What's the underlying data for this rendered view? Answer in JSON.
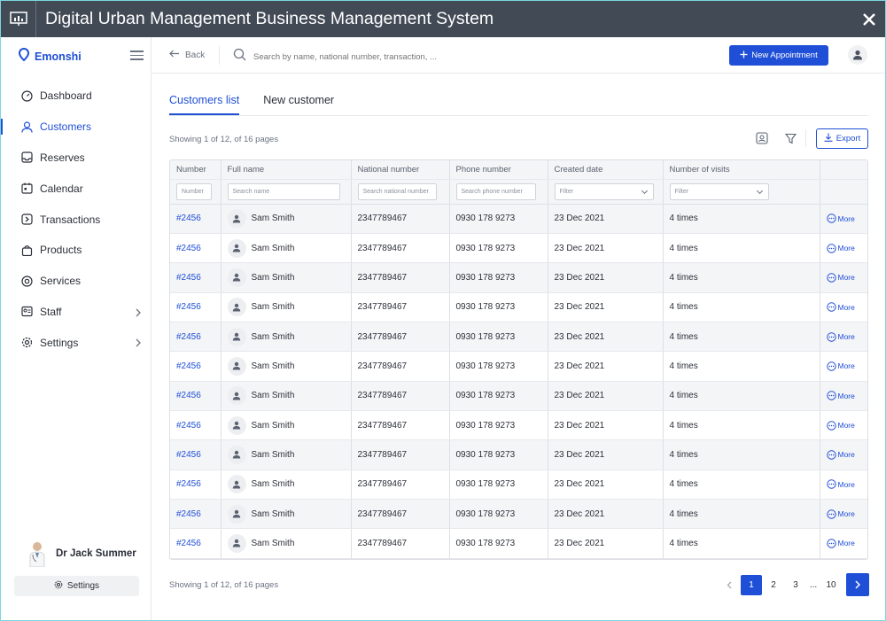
{
  "window": {
    "title": "Digital Urban Management Business Management System"
  },
  "brand": {
    "name": "Emonshi",
    "color": "#1f4fd6"
  },
  "sidebar": {
    "items": [
      {
        "label": "Dashboard",
        "icon": "dashboard-icon",
        "active": false
      },
      {
        "label": "Customers",
        "icon": "user-icon",
        "active": true
      },
      {
        "label": "Reserves",
        "icon": "inbox-icon",
        "active": false
      },
      {
        "label": "Calendar",
        "icon": "calendar-icon",
        "active": false
      },
      {
        "label": "Transactions",
        "icon": "transaction-icon",
        "active": false
      },
      {
        "label": "Products",
        "icon": "bag-icon",
        "active": false
      },
      {
        "label": "Services",
        "icon": "target-icon",
        "active": false
      },
      {
        "label": "Staff",
        "icon": "id-card-icon",
        "active": false,
        "has_submenu": true
      },
      {
        "label": "Settings",
        "icon": "gear-icon",
        "active": false,
        "has_submenu": true
      }
    ],
    "profile_name": "Dr Jack Summer",
    "settings_label": "Settings"
  },
  "header": {
    "back_label": "Back",
    "search_placeholder": "Search by name, national number, transaction, ...",
    "new_appointment_label": "New Appointment"
  },
  "main": {
    "tabs": [
      {
        "label": "Customers list",
        "active": true
      },
      {
        "label": "New customer",
        "active": false
      }
    ],
    "showing_text": "Showing 1 of 12, of 16 pages",
    "export_label": "Export",
    "columns": [
      "Number",
      "Full name",
      "National number",
      "Phone number",
      "Created date",
      "Number of visits"
    ],
    "filters": {
      "number": "Number",
      "name": "Search name",
      "national": "Search national number",
      "phone": "Search phone number",
      "created": "Filter",
      "visits": "Filter"
    },
    "more_label": "More",
    "rows": [
      {
        "number": "#2456",
        "name": "Sam Smith",
        "national": "2347789467",
        "phone": "0930 178 9273",
        "created": "23 Dec 2021",
        "visits": "4 times"
      },
      {
        "number": "#2456",
        "name": "Sam Smith",
        "national": "2347789467",
        "phone": "0930 178 9273",
        "created": "23 Dec 2021",
        "visits": "4 times"
      },
      {
        "number": "#2456",
        "name": "Sam Smith",
        "national": "2347789467",
        "phone": "0930 178 9273",
        "created": "23 Dec 2021",
        "visits": "4 times"
      },
      {
        "number": "#2456",
        "name": "Sam Smith",
        "national": "2347789467",
        "phone": "0930 178 9273",
        "created": "23 Dec 2021",
        "visits": "4 times"
      },
      {
        "number": "#2456",
        "name": "Sam Smith",
        "national": "2347789467",
        "phone": "0930 178 9273",
        "created": "23 Dec 2021",
        "visits": "4 times"
      },
      {
        "number": "#2456",
        "name": "Sam Smith",
        "national": "2347789467",
        "phone": "0930 178 9273",
        "created": "23 Dec 2021",
        "visits": "4 times"
      },
      {
        "number": "#2456",
        "name": "Sam Smith",
        "national": "2347789467",
        "phone": "0930 178 9273",
        "created": "23 Dec 2021",
        "visits": "4 times"
      },
      {
        "number": "#2456",
        "name": "Sam Smith",
        "national": "2347789467",
        "phone": "0930 178 9273",
        "created": "23 Dec 2021",
        "visits": "4 times"
      },
      {
        "number": "#2456",
        "name": "Sam Smith",
        "national": "2347789467",
        "phone": "0930 178 9273",
        "created": "23 Dec 2021",
        "visits": "4 times"
      },
      {
        "number": "#2456",
        "name": "Sam Smith",
        "national": "2347789467",
        "phone": "0930 178 9273",
        "created": "23 Dec 2021",
        "visits": "4 times"
      },
      {
        "number": "#2456",
        "name": "Sam Smith",
        "national": "2347789467",
        "phone": "0930 178 9273",
        "created": "23 Dec 2021",
        "visits": "4 times"
      },
      {
        "number": "#2456",
        "name": "Sam Smith",
        "national": "2347789467",
        "phone": "0930 178 9273",
        "created": "23 Dec 2021",
        "visits": "4 times"
      }
    ],
    "pagination": {
      "pages": [
        "1",
        "2",
        "3",
        "...",
        "10"
      ],
      "current": "1"
    }
  }
}
